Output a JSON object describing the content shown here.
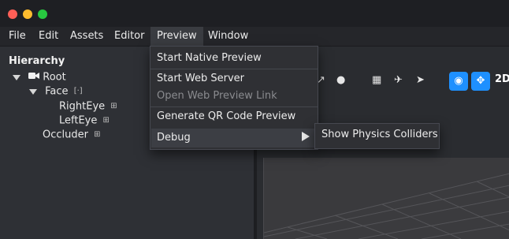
{
  "menubar": {
    "items": [
      {
        "label": "File"
      },
      {
        "label": "Edit"
      },
      {
        "label": "Assets"
      },
      {
        "label": "Editor"
      },
      {
        "label": "Preview"
      },
      {
        "label": "Window"
      }
    ],
    "active": "Preview"
  },
  "hierarchy": {
    "title": "Hierarchy",
    "nodes": [
      {
        "label": "Root",
        "icon": "camera-icon"
      },
      {
        "label": "Face",
        "icon": "face-tracker-icon"
      },
      {
        "label": "RightEye",
        "icon": "grid-icon"
      },
      {
        "label": "LeftEye",
        "icon": "grid-icon"
      },
      {
        "label": "Occluder",
        "icon": "grid-icon"
      }
    ]
  },
  "preview_menu": {
    "items": [
      {
        "label": "Start Native Preview",
        "enabled": true
      },
      {
        "label": "Start Web Server",
        "enabled": true
      },
      {
        "label": "Open Web Preview Link",
        "enabled": false
      },
      {
        "label": "Generate QR Code Preview",
        "enabled": true
      },
      {
        "label": "Debug",
        "enabled": true,
        "submenu": true
      }
    ]
  },
  "debug_submenu": {
    "items": [
      {
        "label": "Show Physics Colliders"
      }
    ]
  },
  "toolbar": {
    "mode_label": "2D",
    "accent": "#1e90ff"
  },
  "colors": {
    "close": "#fe5f57",
    "minimize": "#febc2e",
    "maximize": "#28c840"
  }
}
